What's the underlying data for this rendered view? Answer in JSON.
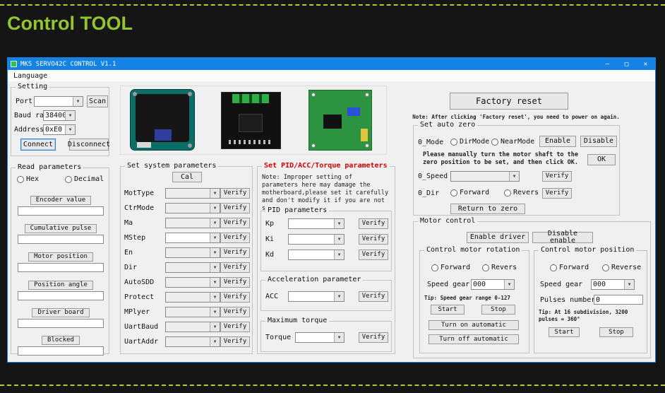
{
  "page": {
    "heading": "Control TOOL"
  },
  "window": {
    "title": "MKS SERVO42C CONTROL V1.1",
    "menu": "Language",
    "controls": {
      "minimize": "—",
      "maximize": "□",
      "close": "✕"
    }
  },
  "labels": {
    "verify": "Verify",
    "start": "Start",
    "stop": "Stop"
  },
  "colors": {
    "accent_blue": "#1583e3",
    "heading_green": "#93c52f",
    "warning_red": "#d40000"
  },
  "setting": {
    "title": "Setting",
    "port_label": "Port",
    "scan": "Scan",
    "baud_label": "Baud rate",
    "baud_value": "38400",
    "address_label": "Address",
    "address_value": "0xE0",
    "connect": "Connect",
    "disconnect": "Disconnect"
  },
  "read_params": {
    "title": "Read parameters",
    "hex": "Hex",
    "decimal": "Decimal",
    "items": [
      "Encoder value",
      "Cumulative pulse",
      "Motor position",
      "Position angle",
      "Driver board",
      "Blocked"
    ]
  },
  "sys_params": {
    "title": "Set system parameters",
    "cal": "Cal",
    "rows": [
      "MotType",
      "CtrMode",
      "Ma",
      "MStep",
      "En",
      "Dir",
      "AutoSDD",
      "Protect",
      "MPlyer",
      "UartBaud",
      "UartAddr"
    ]
  },
  "pid_section": {
    "title": "Set PID/ACC/Torque parameters",
    "note": "Note: Improper setting of parameters here may damage the motherboard,please set it carefully and don't modify it if you are not sure.",
    "pid_title": "PID parameters",
    "rows": [
      "Kp",
      "Ki",
      "Kd"
    ],
    "acc_title": "Acceleration parameter",
    "acc_label": "ACC",
    "torque_title": "Maximum torque",
    "torque_label": "Torque"
  },
  "factory": {
    "button": "Factory reset",
    "note": "Note: After clicking 'Factory reset', you need to power on again."
  },
  "auto_zero": {
    "title": "Set auto zero",
    "mode_label": "0_Mode",
    "dirmode": "DirMode",
    "nearmode": "NearMode",
    "enable": "Enable",
    "disable": "Disable",
    "instruction": "Please manually turn the motor shaft to the zero position to be set, and then click OK.",
    "ok": "OK",
    "speed_label": "0_Speed",
    "dir_label": "0_Dir",
    "forward": "Forward",
    "revers": "Revers",
    "return_to_zero": "Return to zero"
  },
  "motor_control": {
    "title": "Motor control",
    "enable_driver": "Enable driver",
    "disable_enable": "Disable enable",
    "rotation": {
      "title": "Control motor rotation",
      "forward": "Forward",
      "revers": "Revers",
      "speed_gear": "Speed gear",
      "speed_value": "000",
      "tip": "Tip: Speed gear range 0-127",
      "auto_on": "Turn on automatic",
      "auto_off": "Turn off automatic"
    },
    "position": {
      "title": "Control motor position",
      "forward": "Forward",
      "reverse": "Reverse",
      "speed_gear": "Speed gear",
      "speed_value": "000",
      "pulses_label": "Pulses number",
      "pulses_value": "0",
      "tip": "Tip: At 16 subdivision, 3200 pulses = 360°"
    }
  }
}
